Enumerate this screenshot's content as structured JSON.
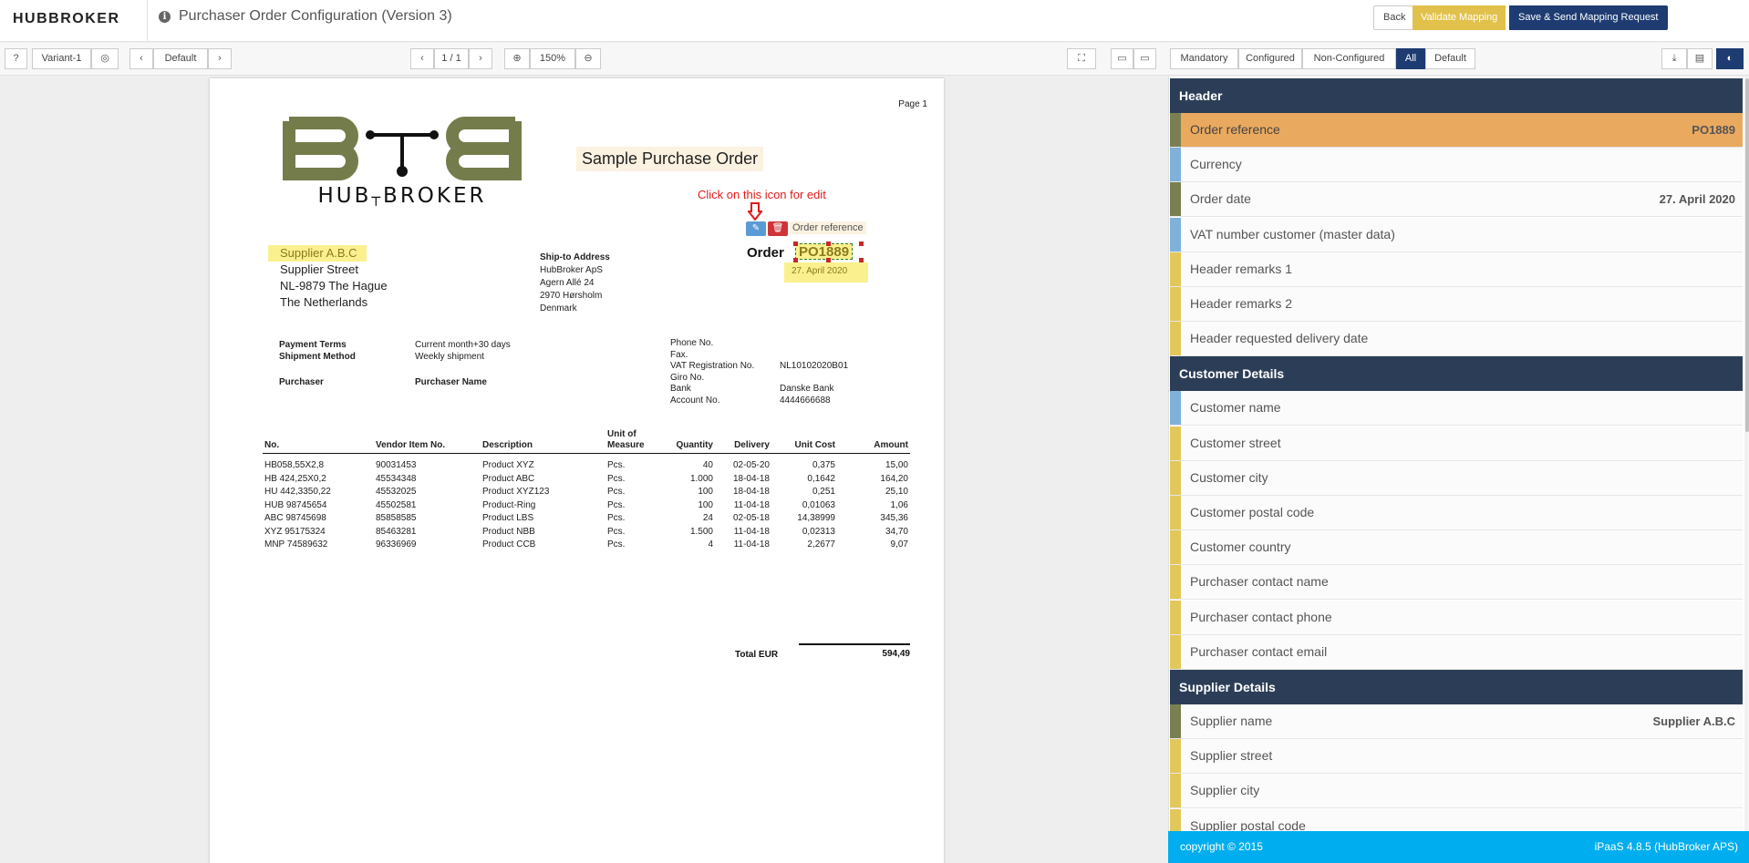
{
  "app": {
    "logo": "HUBBROKER",
    "title": "Purchaser Order Configuration (Version 3)"
  },
  "actions": {
    "back": "Back",
    "validate": "Validate Mapping",
    "save": "Save & Send Mapping Request"
  },
  "toolbar": {
    "variant": "Variant-1",
    "layout": "Default",
    "page": "1 / 1",
    "zoom": "150%",
    "filters": [
      "Mandatory",
      "Configured",
      "Non-Configured",
      "All",
      "Default"
    ],
    "active_filter": "All"
  },
  "document": {
    "page_label": "Page 1",
    "title": "Sample Purchase Order",
    "edit_hint": "Click on this icon for edit",
    "order_reference_tag": "Order reference",
    "order_label": "Order",
    "order_number": "PO1889",
    "order_date": "27. April 2020",
    "supplier": [
      "Supplier A.B.C",
      "Supplier Street",
      "NL-9879 The Hague",
      "The Netherlands"
    ],
    "ship_to": {
      "heading": "Ship-to Address",
      "lines": [
        "HubBroker ApS",
        "Agern Allé 24",
        "2970 Hørsholm",
        "Denmark"
      ]
    },
    "terms": {
      "payment_label": "Payment Terms",
      "payment_value": "Current month+30 days",
      "shipment_label": "Shipment Method",
      "shipment_value": "Weekly shipment",
      "purchaser_label": "Purchaser",
      "purchaser_value": "Purchaser Name"
    },
    "contact": {
      "labels": [
        "Phone No.",
        "Fax.",
        "VAT Registration No.",
        "Giro No.",
        "Bank",
        "Account No."
      ],
      "values": [
        "",
        "",
        "NL10102020B01",
        "",
        "Danske Bank",
        "4444666688"
      ]
    },
    "table": {
      "headers": [
        "No.",
        "Vendor Item No.",
        "Description",
        "Unit of Measure",
        "Quantity",
        "Delivery",
        "Unit Cost",
        "Amount"
      ],
      "rows": [
        [
          "HB058,55X2,8",
          "90031453",
          "Product XYZ",
          "Pcs.",
          "40",
          "02-05-20",
          "0,375",
          "15,00"
        ],
        [
          "HB 424,25X0,2",
          "45534348",
          "Product ABC",
          "Pcs.",
          "1.000",
          "18-04-18",
          "0,1642",
          "164,20"
        ],
        [
          "HU 442,3350,22",
          "45532025",
          "Product XYZ123",
          "Pcs.",
          "100",
          "18-04-18",
          "0,251",
          "25,10"
        ],
        [
          "HUB 98745654",
          "45502581",
          "Product-Ring",
          "Pcs.",
          "100",
          "11-04-18",
          "0,01063",
          "1,06"
        ],
        [
          "ABC 98745698",
          "85858585",
          "Product LBS",
          "Pcs.",
          "24",
          "02-05-18",
          "14,38999",
          "345,36"
        ],
        [
          "XYZ 95175324",
          "85463281",
          "Product NBB",
          "Pcs.",
          "1.500",
          "11-04-18",
          "0,02313",
          "34,70"
        ],
        [
          "MNP 74589632",
          "96336969",
          "Product CCB",
          "Pcs.",
          "4",
          "11-04-18",
          "2,2677",
          "9,07"
        ]
      ],
      "total_label": "Total EUR",
      "total_value": "594,49"
    }
  },
  "panel": {
    "sections": [
      {
        "title": "Header",
        "fields": [
          {
            "label": "Order reference",
            "value": "PO1889",
            "status": "olive",
            "active": true
          },
          {
            "label": "Currency",
            "value": "",
            "status": "blue"
          },
          {
            "label": "Order date",
            "value": "27. April 2020",
            "status": "olive"
          },
          {
            "label": "VAT number customer (master data)",
            "value": "",
            "status": "blue"
          },
          {
            "label": "Header remarks 1",
            "value": "",
            "status": "yellow"
          },
          {
            "label": "Header remarks 2",
            "value": "",
            "status": "yellow"
          },
          {
            "label": "Header requested delivery date",
            "value": "",
            "status": "yellow"
          }
        ]
      },
      {
        "title": "Customer Details",
        "fields": [
          {
            "label": "Customer name",
            "value": "",
            "status": "blue"
          },
          {
            "label": "Customer street",
            "value": "",
            "status": "yellow"
          },
          {
            "label": "Customer city",
            "value": "",
            "status": "yellow"
          },
          {
            "label": "Customer postal code",
            "value": "",
            "status": "yellow"
          },
          {
            "label": "Customer country",
            "value": "",
            "status": "yellow"
          },
          {
            "label": "Purchaser contact name",
            "value": "",
            "status": "yellow"
          },
          {
            "label": "Purchaser contact phone",
            "value": "",
            "status": "yellow"
          },
          {
            "label": "Purchaser contact email",
            "value": "",
            "status": "yellow"
          }
        ]
      },
      {
        "title": "Supplier Details",
        "fields": [
          {
            "label": "Supplier name",
            "value": "Supplier A.B.C",
            "status": "olive"
          },
          {
            "label": "Supplier street",
            "value": "",
            "status": "yellow"
          },
          {
            "label": "Supplier city",
            "value": "",
            "status": "yellow"
          },
          {
            "label": "Supplier postal code",
            "value": "",
            "status": "yellow"
          }
        ]
      }
    ],
    "status_colors": {
      "olive": "#7a7f52",
      "blue": "#7fb1d9",
      "yellow": "#e2c75a",
      "active": "#e9a95f"
    }
  },
  "footer": {
    "copyright": "copyright © 2015",
    "version": "iPaaS 4.8.5 (HubBroker APS)"
  }
}
